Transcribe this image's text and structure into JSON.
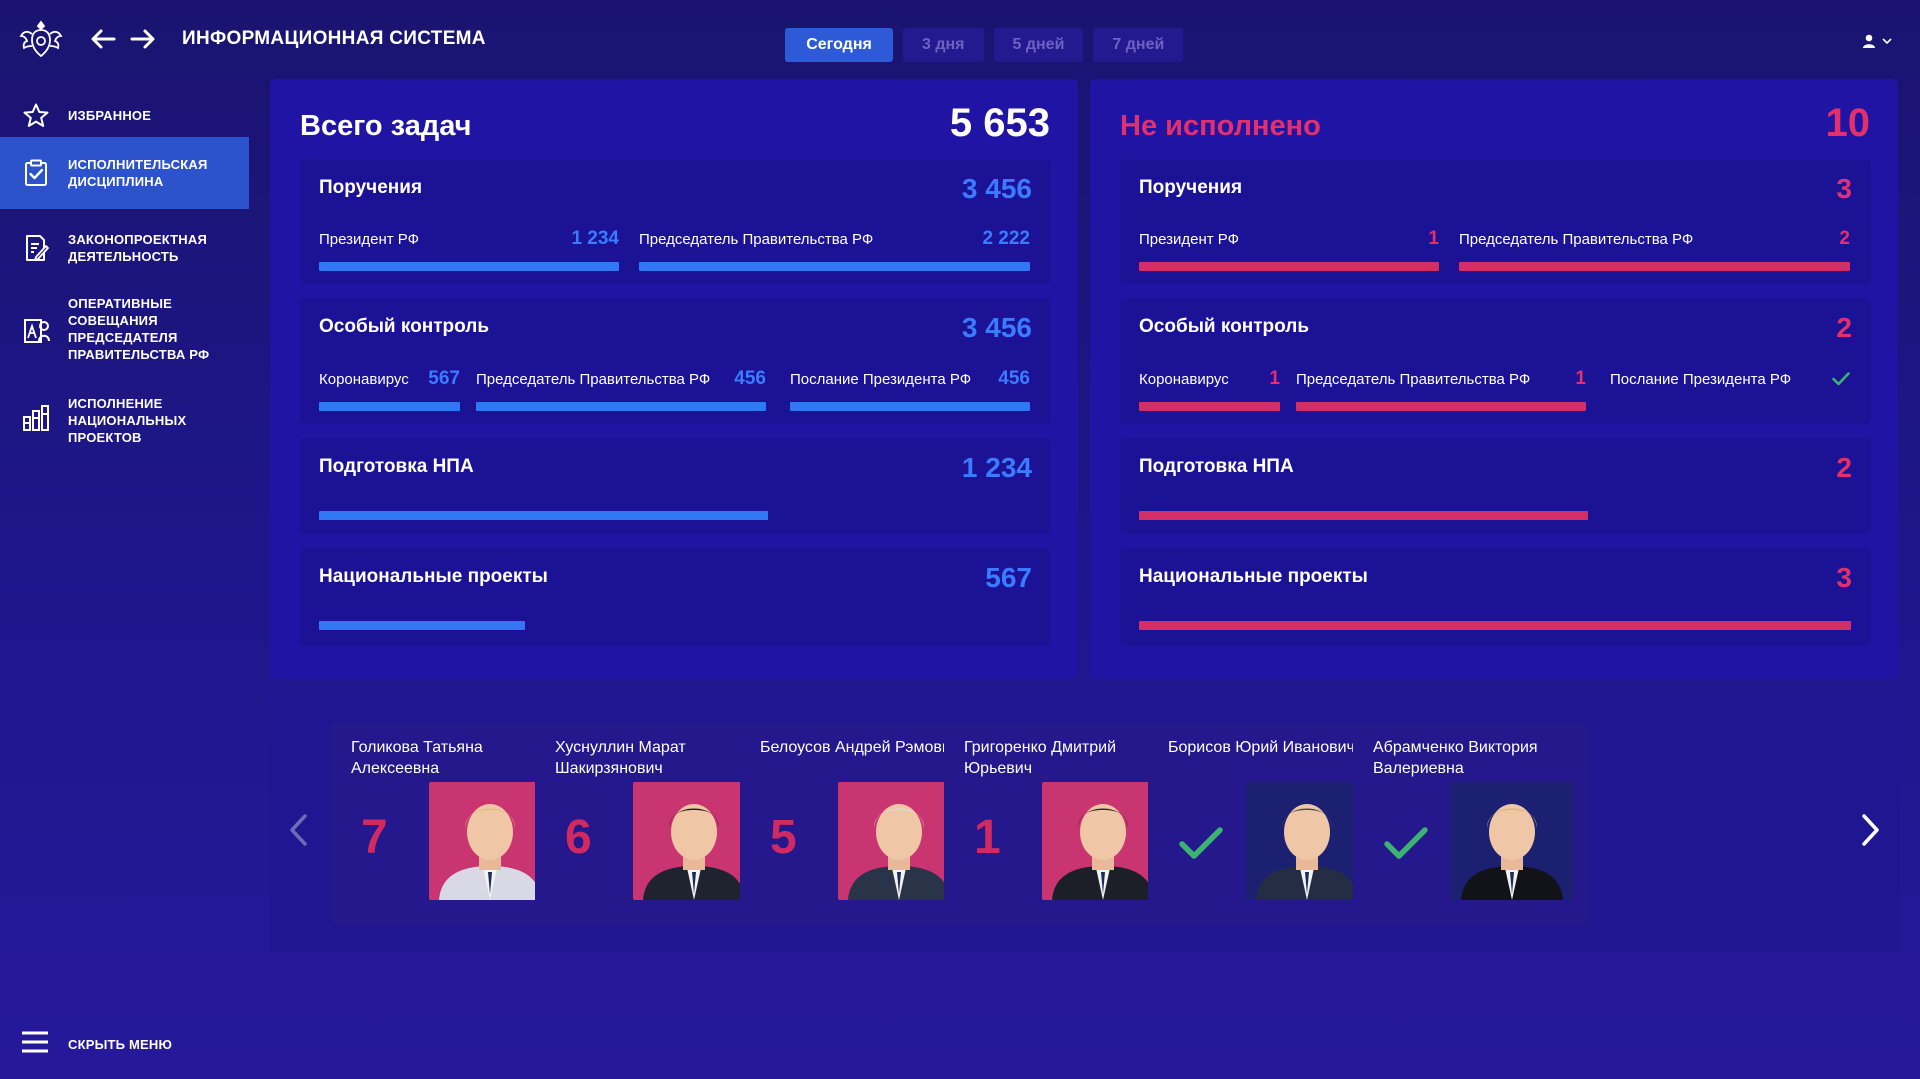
{
  "header": {
    "title": "ИНФОРМАЦИОННАЯ СИСТЕМА",
    "period_tabs": [
      "Сегодня",
      "3 дня",
      "5 дней",
      "7 дней"
    ],
    "active_period": "Сегодня"
  },
  "sidebar": {
    "items": [
      {
        "label": "ИЗБРАННОЕ",
        "icon": "star-icon"
      },
      {
        "label": "ИСПОЛНИТЕЛЬСКАЯ ДИСЦИПЛИНА",
        "icon": "clipboard-check-icon",
        "active": true
      },
      {
        "label": "ЗАКОНОПРОЕКТНАЯ ДЕЯТЕЛЬНОСТЬ",
        "icon": "document-edit-icon"
      },
      {
        "label": "ОПЕРАТИВНЫЕ СОВЕЩАНИЯ ПРЕДСЕДАТЕЛЯ ПРАВИТЕЛЬСТВА РФ",
        "icon": "meeting-icon"
      },
      {
        "label": "ИСПОЛНЕНИЕ НАЦИОНАЛЬНЫХ ПРОЕКТОВ",
        "icon": "bar-chart-icon"
      }
    ],
    "hide_menu": "СКРЫТЬ МЕНЮ"
  },
  "colors": {
    "accent_blue": "#3178f5",
    "accent_pink": "#d42e66",
    "ok_green": "#3cb371"
  },
  "total": {
    "title": "Всего задач",
    "value": "5 653",
    "cards": [
      {
        "title": "Поручения",
        "value": "3 456",
        "subs": [
          {
            "label": "Президент РФ",
            "value": "1 234",
            "fill": 1.0
          },
          {
            "label": "Председатель Правительства РФ",
            "value": "2 222",
            "fill": 1.0
          }
        ]
      },
      {
        "title": "Особый контроль",
        "value": "3 456",
        "subs": [
          {
            "label": "Коронавирус",
            "value": "567",
            "fill": 1.0
          },
          {
            "label": "Председатель Правительства РФ",
            "value": "456",
            "fill": 1.0
          },
          {
            "label": "Послание Президента РФ",
            "value": "456",
            "fill": 1.0
          }
        ]
      },
      {
        "title": "Подготовка НПА",
        "value": "1 234",
        "fill": 0.63
      },
      {
        "title": "Национальные проекты",
        "value": "567",
        "fill": 0.29
      }
    ]
  },
  "unfulfilled": {
    "title": "Не исполнено",
    "value": "10",
    "cards": [
      {
        "title": "Поручения",
        "value": "3",
        "subs": [
          {
            "label": "Президент РФ",
            "value": "1",
            "fill": 1.0
          },
          {
            "label": "Председатель Правительства РФ",
            "value": "2",
            "fill": 1.0
          }
        ]
      },
      {
        "title": "Особый контроль",
        "value": "2",
        "subs": [
          {
            "label": "Коронавирус",
            "value": "1",
            "fill": 1.0
          },
          {
            "label": "Председатель Правительства РФ",
            "value": "1",
            "fill": 1.0
          },
          {
            "label": "Послание Президента РФ",
            "value": "",
            "done": true
          }
        ]
      },
      {
        "title": "Подготовка НПА",
        "value": "2",
        "fill": 0.63
      },
      {
        "title": "Национальные проекты",
        "value": "3",
        "fill": 1.0
      }
    ]
  },
  "people": [
    {
      "name": "Голикова Татьяна Алексеевна",
      "count": "7",
      "bg": "#c93570",
      "hair": "#e0c27a",
      "suit": "#d9d9e6"
    },
    {
      "name": "Хуснуллин Марат Шакирзянович",
      "count": "6",
      "bg": "#c93570",
      "hair": "#2b1f1a",
      "suit": "#1f2330"
    },
    {
      "name": "Белоусов Андрей Рэмович",
      "count": "5",
      "bg": "#c93570",
      "hair": "#d8d8d8",
      "suit": "#2a3448"
    },
    {
      "name": "Григоренко Дмитрий Юрьевич",
      "count": "1",
      "bg": "#c93570",
      "hair": "#3a2a20",
      "suit": "#1d1f28"
    },
    {
      "name": "Борисов Юрий Иванович",
      "count": "",
      "done": true,
      "bg": "#1b2070",
      "hair": "#4a4a50",
      "suit": "#252d45"
    },
    {
      "name": "Абрамченко Виктория Валериевна",
      "count": "",
      "done": true,
      "bg": "#1b2070",
      "hair": "#d4b86e",
      "suit": "#121318"
    }
  ]
}
